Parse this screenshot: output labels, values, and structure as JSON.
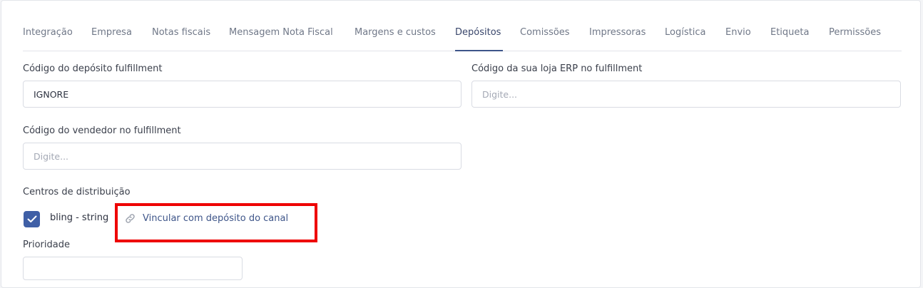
{
  "tabs": [
    {
      "label": "Integração",
      "active": false
    },
    {
      "label": "Empresa",
      "active": false
    },
    {
      "label": "Notas fiscais",
      "active": false
    },
    {
      "label": "Mensagem Nota Fiscal",
      "active": false
    },
    {
      "label": "Margens e custos",
      "active": false
    },
    {
      "label": "Depósitos",
      "active": true
    },
    {
      "label": "Comissões",
      "active": false
    },
    {
      "label": "Impressoras",
      "active": false
    },
    {
      "label": "Logística",
      "active": false
    },
    {
      "label": "Envio",
      "active": false
    },
    {
      "label": "Etiqueta",
      "active": false
    },
    {
      "label": "Permissões",
      "active": false
    }
  ],
  "form": {
    "deposit_code": {
      "label": "Código do depósito fulfillment",
      "value": "IGNORE",
      "placeholder": "Digite..."
    },
    "erp_store_code": {
      "label": "Código da sua loja ERP no fulfillment",
      "value": "",
      "placeholder": "Digite..."
    },
    "seller_code": {
      "label": "Código do vendedor no fulfillment",
      "value": "",
      "placeholder": "Digite..."
    },
    "distribution_centers": {
      "label": "Centros de distribuição",
      "items": [
        {
          "name": "bling - string",
          "checked": true,
          "link_label": "Vincular com depósito do canal"
        }
      ]
    },
    "priority": {
      "label": "Prioridade",
      "value": "",
      "placeholder": ""
    }
  },
  "colors": {
    "accent": "#3e5589",
    "checkbox": "#3f5fa6",
    "highlight": "#ee0000"
  }
}
